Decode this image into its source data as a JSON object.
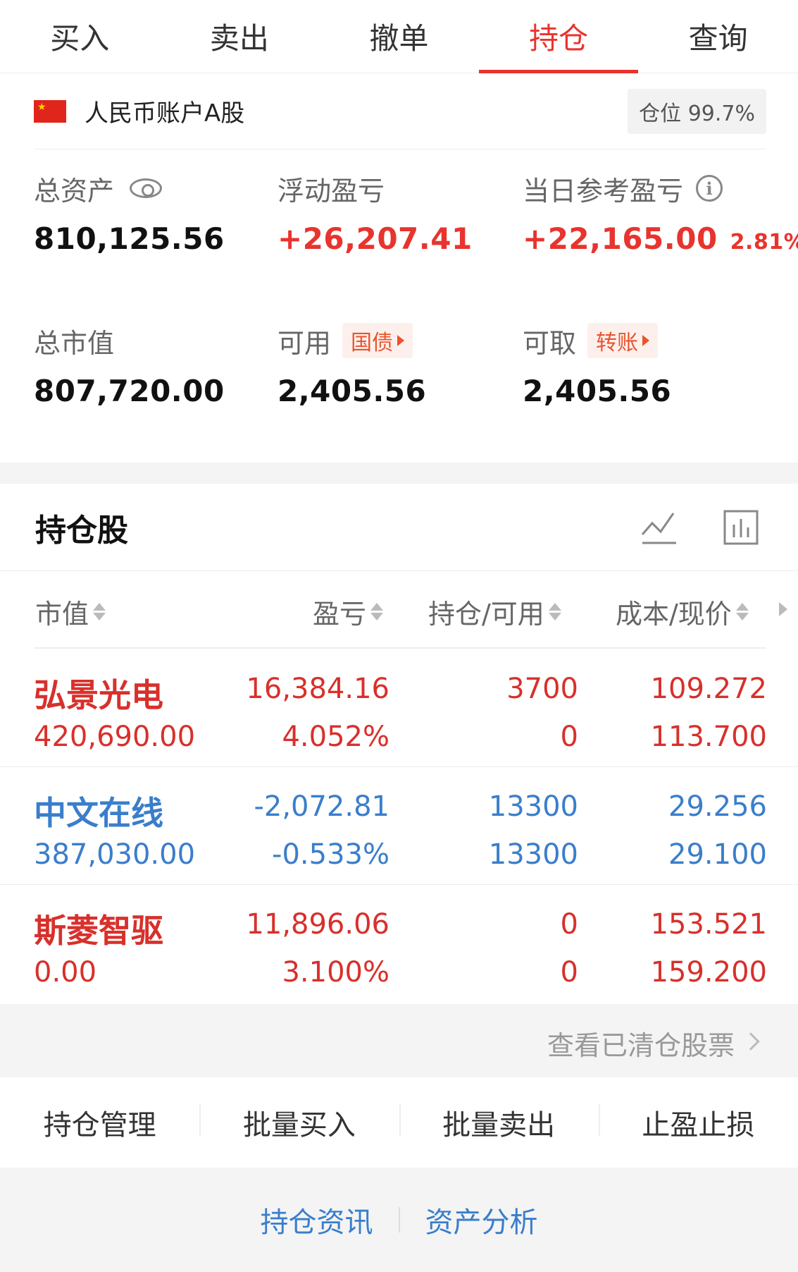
{
  "tabs": [
    {
      "label": "买入",
      "active": false
    },
    {
      "label": "卖出",
      "active": false
    },
    {
      "label": "撤单",
      "active": false
    },
    {
      "label": "持仓",
      "active": true
    },
    {
      "label": "查询",
      "active": false
    }
  ],
  "account": {
    "name": "人民币账户A股",
    "position_badge": "仓位 99.7%",
    "flag_icon": "china-flag-icon"
  },
  "summary": {
    "total_assets": {
      "label": "总资产",
      "value": "810,125.56"
    },
    "floating_pl": {
      "label": "浮动盈亏",
      "value": "+26,207.41"
    },
    "daily_pl": {
      "label": "当日参考盈亏",
      "value": "+22,165.00",
      "pct": "2.81%"
    },
    "market_value": {
      "label": "总市值",
      "value": "807,720.00"
    },
    "available": {
      "label": "可用",
      "tag": "国债",
      "value": "2,405.56"
    },
    "withdrawable": {
      "label": "可取",
      "tag": "转账",
      "value": "2,405.56"
    }
  },
  "holdings": {
    "title": "持仓股",
    "columns": [
      "市值",
      "盈亏",
      "持仓/可用",
      "成本/现价"
    ],
    "rows": [
      {
        "name": "弘景光电",
        "market_value": "420,690.00",
        "pl": "16,384.16",
        "pl_pct": "4.052%",
        "position": "3700",
        "available": "0",
        "cost": "109.272",
        "price": "113.700",
        "color": "#d8302b"
      },
      {
        "name": "中文在线",
        "market_value": "387,030.00",
        "pl": "-2,072.81",
        "pl_pct": "-0.533%",
        "position": "13300",
        "available": "13300",
        "cost": "29.256",
        "price": "29.100",
        "color": "#3a7ecb"
      },
      {
        "name": "斯菱智驱",
        "market_value": "0.00",
        "pl": "11,896.06",
        "pl_pct": "3.100%",
        "position": "0",
        "available": "0",
        "cost": "153.521",
        "price": "159.200",
        "color": "#d8302b"
      }
    ]
  },
  "cleared_link": "查看已清仓股票",
  "actions": [
    "持仓管理",
    "批量买入",
    "批量卖出",
    "止盈止损"
  ],
  "footer_links": [
    "持仓资讯",
    "资产分析"
  ],
  "colors": {
    "accent": "#e8342e",
    "down": "#3a7ecb"
  }
}
